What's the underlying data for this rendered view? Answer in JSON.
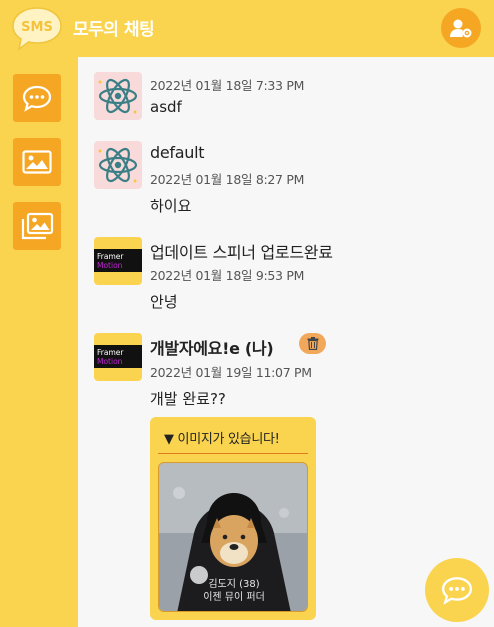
{
  "header": {
    "logo_text": "SMS",
    "title": "모두의 채팅",
    "profile_icon": "user-settings-icon"
  },
  "sidebar": {
    "items": [
      {
        "name": "chat",
        "icon": "chat-bubble-icon"
      },
      {
        "name": "image",
        "icon": "image-icon"
      },
      {
        "name": "gallery",
        "icon": "gallery-icon"
      }
    ]
  },
  "messages": [
    {
      "name": "",
      "time": "2022년 01월 18일 7:33 PM",
      "text": "asdf",
      "avatar": "react-logo"
    },
    {
      "name": "default",
      "time": "2022년 01월 18일 8:27 PM",
      "text": "하이요",
      "avatar": "react-logo"
    },
    {
      "name": "업데이트 스피너 업로드완료",
      "time": "2022년 01월 18일 9:53 PM",
      "text": "안녕",
      "avatar": "framer-motion-logo"
    },
    {
      "name": "개발자에요!e (나)",
      "time": "2022년 01월 19일 11:07 PM",
      "text": "개발 완료??",
      "avatar": "framer-motion-logo",
      "is_me": true,
      "attachment": {
        "title": "▼ 이미지가 있습니다!",
        "caption_line1": "김도지 (38)",
        "caption_line2": "이젠 뮤이 퍼더"
      }
    }
  ],
  "avatar_logo": {
    "line1": "Framer",
    "line2": "Motion"
  },
  "colors": {
    "primary": "#fad44f",
    "accent": "#f5a623",
    "background": "#f7f7f7"
  }
}
